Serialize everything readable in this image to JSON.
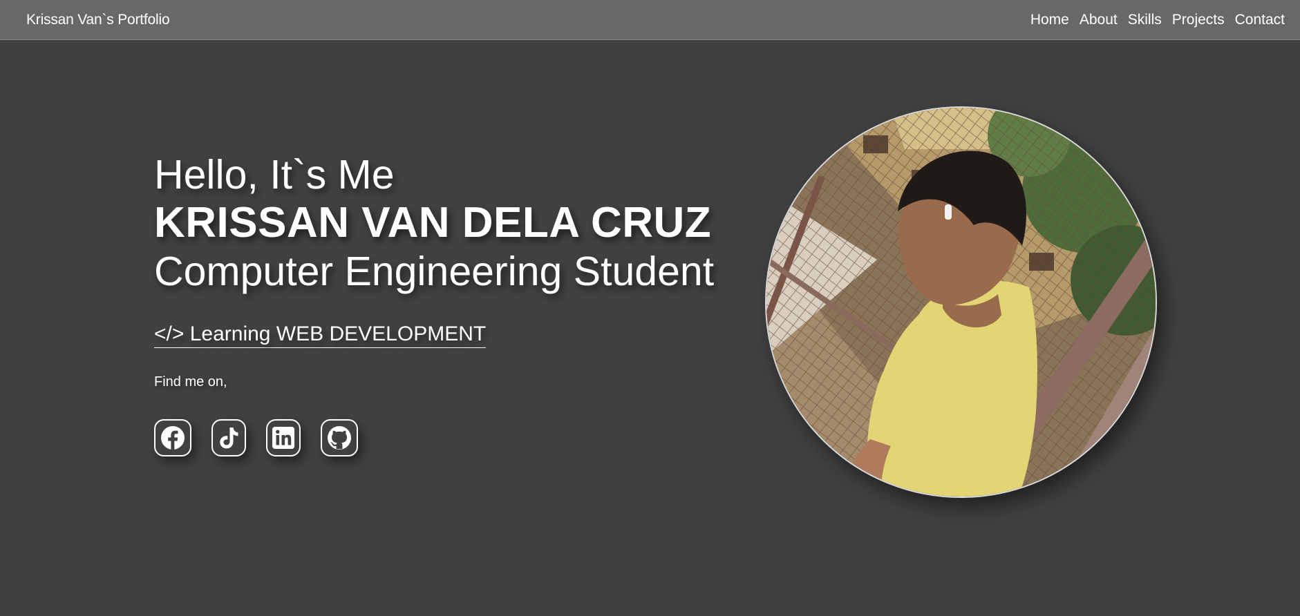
{
  "nav": {
    "brand": "Krissan Van`s Portfolio",
    "links": [
      "Home",
      "About",
      "Skills",
      "Projects",
      "Contact"
    ]
  },
  "hero": {
    "greeting": "Hello, It`s Me",
    "name": "KRISSAN VAN DELA CRUZ",
    "role": "Computer Engineering Student",
    "learning": "</> Learning WEB DEVELOPMENT",
    "find_me": "Find me on,"
  },
  "socials": [
    {
      "icon": "facebook-icon"
    },
    {
      "icon": "tiktok-icon"
    },
    {
      "icon": "linkedin-icon"
    },
    {
      "icon": "github-icon"
    }
  ],
  "colors": {
    "background": "#404142",
    "navbar": "#67686a",
    "text": "#ffffff"
  }
}
